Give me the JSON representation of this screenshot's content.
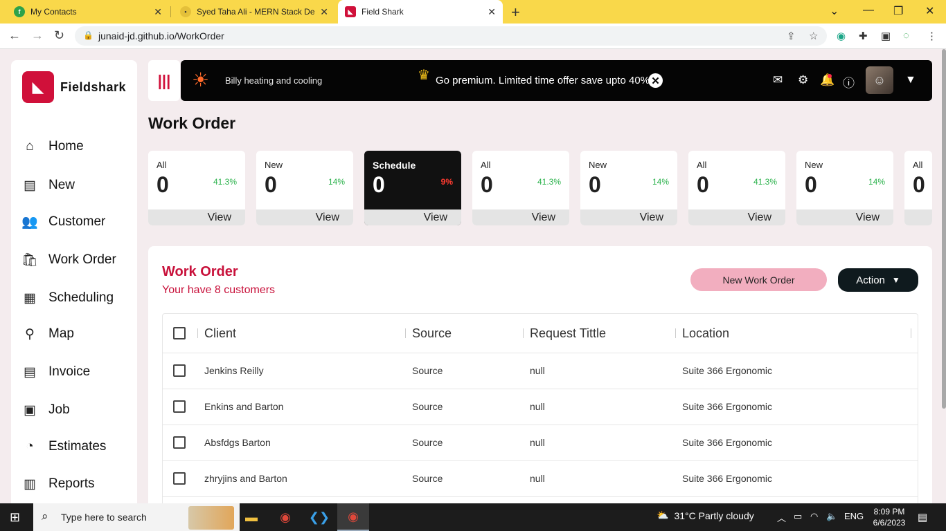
{
  "browser": {
    "tabs": [
      {
        "title": "My Contacts",
        "favicon_color": "#2ea24a",
        "favicon_glyph": "f",
        "active": false
      },
      {
        "title": "Syed Taha Ali - MERN Stack Deve",
        "favicon_color": "#c9a000",
        "favicon_glyph": "•",
        "active": false
      },
      {
        "title": "Field Shark",
        "favicon_color": "#d0103a",
        "favicon_glyph": "◣",
        "active": true
      }
    ],
    "url": "junaid-jd.github.io/WorkOrder"
  },
  "sidebar": {
    "logo_text": "Fieldshark",
    "items": [
      {
        "label": "Home",
        "icon": "home-icon",
        "glyph": "⌂"
      },
      {
        "label": "New",
        "icon": "new-document-icon",
        "glyph": "▤"
      },
      {
        "label": "Customer",
        "icon": "customer-group-icon",
        "glyph": "👥"
      },
      {
        "label": "Work Order",
        "icon": "work-order-bag-icon",
        "glyph": "🛍"
      },
      {
        "label": "Scheduling",
        "icon": "calendar-icon",
        "glyph": "▦"
      },
      {
        "label": "Map",
        "icon": "map-pin-icon",
        "glyph": "⚲"
      },
      {
        "label": "Invoice",
        "icon": "invoice-icon",
        "glyph": "▤"
      },
      {
        "label": "Job",
        "icon": "briefcase-icon",
        "glyph": "▣"
      },
      {
        "label": "Estimates",
        "icon": "estimates-icon",
        "glyph": "◔"
      },
      {
        "label": "Reports",
        "icon": "reports-icon",
        "glyph": "▥"
      }
    ]
  },
  "header": {
    "company_name": "Billy heating and cooling",
    "promo_text": "Go premium. Limited time offer save upto 40%."
  },
  "page": {
    "title": "Work Order"
  },
  "stats": [
    {
      "label": "All",
      "value": "0",
      "percent": "41.3%",
      "view": "View",
      "dark": false
    },
    {
      "label": "New",
      "value": "0",
      "percent": "14%",
      "view": "View",
      "dark": false
    },
    {
      "label": "Schedule",
      "value": "0",
      "percent": "9%",
      "view": "View",
      "dark": true
    },
    {
      "label": "All",
      "value": "0",
      "percent": "41.3%",
      "view": "View",
      "dark": false
    },
    {
      "label": "New",
      "value": "0",
      "percent": "14%",
      "view": "View",
      "dark": false
    },
    {
      "label": "All",
      "value": "0",
      "percent": "41.3%",
      "view": "View",
      "dark": false
    },
    {
      "label": "New",
      "value": "0",
      "percent": "14%",
      "view": "View",
      "dark": false
    },
    {
      "label": "All",
      "value": "0",
      "percent": "",
      "view": "",
      "dark": false
    }
  ],
  "panel": {
    "title": "Work Order",
    "subtitle": "Your have 8 customers",
    "new_button": "New Work Order",
    "action_button": "Action"
  },
  "table": {
    "columns": [
      "Client",
      "Source",
      "Request Tittle",
      "Location"
    ],
    "rows": [
      {
        "client": "Jenkins Reilly",
        "source": "Source",
        "request": "null",
        "location": "Suite 366 Ergonomic"
      },
      {
        "client": "Enkins and Barton",
        "source": "Source",
        "request": "null",
        "location": "Suite 366 Ergonomic"
      },
      {
        "client": "Absfdgs Barton",
        "source": "Source",
        "request": "null",
        "location": "Suite 366 Ergonomic"
      },
      {
        "client": "zhryjins and Barton",
        "source": "Source",
        "request": "null",
        "location": "Suite 366 Ergonomic"
      }
    ]
  },
  "taskbar": {
    "search_placeholder": "Type here to search",
    "weather": "31°C  Partly cloudy",
    "language": "ENG",
    "time": "8:09 PM",
    "date": "6/6/2023"
  },
  "colors": {
    "brand": "#d0103a",
    "tab_strip": "#f9d84a",
    "positive": "#2bb24c",
    "negative": "#ff3b30"
  }
}
